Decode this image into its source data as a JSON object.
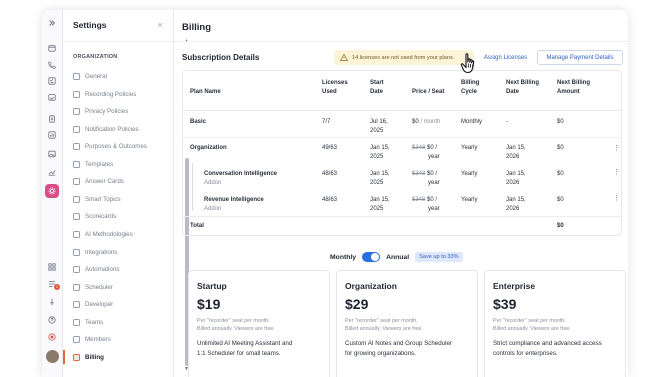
{
  "sidebar": {
    "title": "Settings",
    "collapse_glyph": "«",
    "section": "ORGANIZATION",
    "items": [
      {
        "label": "General"
      },
      {
        "label": "Recording Policies"
      },
      {
        "label": "Privacy Policies"
      },
      {
        "label": "Notification Policies"
      },
      {
        "label": "Purposes & Outcomes"
      },
      {
        "label": "Templates"
      },
      {
        "label": "Answer Cards"
      },
      {
        "label": "Smart Topics"
      },
      {
        "label": "Scorecards"
      },
      {
        "label": "AI Methodologies"
      },
      {
        "label": "Integrations"
      },
      {
        "label": "Automations"
      },
      {
        "label": "Scheduler"
      },
      {
        "label": "Developer"
      },
      {
        "label": "Teams"
      },
      {
        "label": "Members"
      },
      {
        "label": "Billing"
      }
    ]
  },
  "rail": {
    "notification_count": "1",
    "accent": "#d94f8a"
  },
  "main": {
    "title": "Billing",
    "subscription_title": "Subscription Details",
    "warning": "14 licenses are not used from your plans.",
    "assign_label": "Assign Licenses",
    "manage_label": "Manage Payment Details",
    "table": {
      "headers": {
        "plan": "Plan Name",
        "licenses": [
          "Licenses",
          "Used"
        ],
        "start": [
          "Start",
          "Date"
        ],
        "price": "Price / Seat",
        "cycle": [
          "Billing",
          "Cycle"
        ],
        "next": [
          "Next Billing",
          "Date"
        ],
        "amount": [
          "Next Billing",
          "Amount"
        ]
      },
      "rows": [
        {
          "plan": "Basic",
          "licenses": "7/7",
          "start": [
            "Jul 16,",
            "2025"
          ],
          "price_strike": "",
          "price": "$0",
          "per": "/ month",
          "cycle": "Monthly",
          "next": [
            "-",
            ""
          ],
          "amount": "$0",
          "addon": ""
        },
        {
          "plan": "Organization",
          "licenses": "49/63",
          "start": [
            "Jan 15,",
            "2025"
          ],
          "price_strike": "$348",
          "price": "$0 /",
          "per": "year",
          "cycle": "Yearly",
          "next": [
            "Jan 15,",
            "2026"
          ],
          "amount": "$0",
          "addon": ""
        },
        {
          "plan": "Conversation Intelligence",
          "licenses": "48/63",
          "start": [
            "Jan 15,",
            "2025"
          ],
          "price_strike": "$348",
          "price": "$0 /",
          "per": "year",
          "cycle": "Yearly",
          "next": [
            "Jan 15,",
            "2026"
          ],
          "amount": "$0",
          "addon": "Addon"
        },
        {
          "plan": "Revenue Intelligence",
          "licenses": "48/63",
          "start": [
            "Jan 15,",
            "2025"
          ],
          "price_strike": "$348",
          "price": "$0 /",
          "per": "year",
          "cycle": "Yearly",
          "next": [
            "Jan 15,",
            "2026"
          ],
          "amount": "$0",
          "addon": "Addon"
        }
      ],
      "total_label": "Total",
      "total_amount": "$0"
    },
    "billing_toggle": {
      "monthly": "Monthly",
      "annual": "Annual",
      "save_badge": "Save up to 33%",
      "selected": "Annual"
    },
    "plans": [
      {
        "name": "Startup",
        "price": "$19",
        "note1": "Per \"recorder\" seat per month.",
        "note2": "Billed annually. Viewers are free.",
        "desc1": "Unlimited AI Meeting Assistant and",
        "desc2": "1:1 Scheduler for small teams."
      },
      {
        "name": "Organization",
        "price": "$29",
        "note1": "Per \"recorder\" seat per month.",
        "note2": "Billed annually. Viewers are free.",
        "desc1": "Custom AI Notes and Group Scheduler",
        "desc2": "for growing organizations."
      },
      {
        "name": "Enterprise",
        "price": "$39",
        "note1": "Per \"recorder\" seat per month.",
        "note2": "Billed annually. Viewers are free.",
        "desc1": "Strict compliance and advanced access",
        "desc2": "controls for enterprises."
      }
    ]
  }
}
